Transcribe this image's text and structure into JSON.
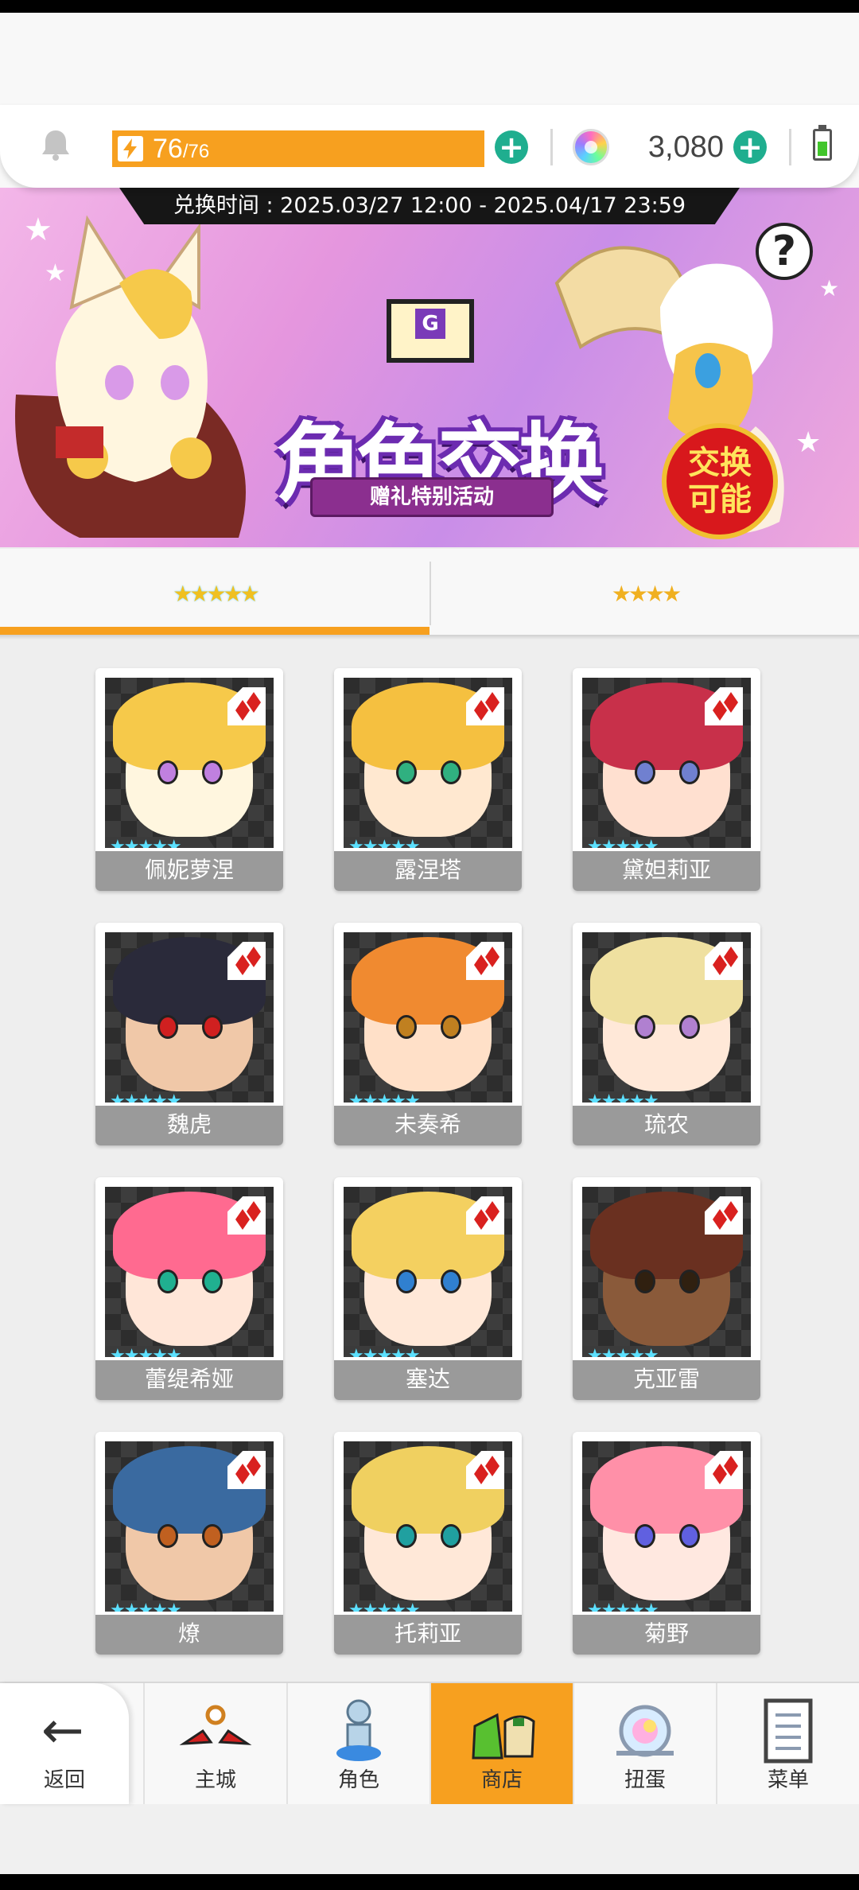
{
  "hud": {
    "stamina_value": "76",
    "stamina_max": "/76",
    "stamina_fraction": 1.0,
    "gem_count": "3,080",
    "icons": [
      "bell-icon",
      "lightning-icon",
      "plus-icon",
      "gem-icon",
      "battery-icon"
    ]
  },
  "banner": {
    "date_range": "兑换时间 : 2025.03/27 12:00 - 2025.04/17 23:59",
    "title": "角色交换",
    "subtitle": "赠礼特别活动",
    "badge_line1": "交换",
    "badge_line2": "可能",
    "help": "?",
    "envelope_letter": "G"
  },
  "tabs": [
    {
      "stars": "★★★★★",
      "rarity": 5,
      "active": true
    },
    {
      "stars": "★★★★",
      "rarity": 4,
      "active": false
    }
  ],
  "characters": [
    {
      "name": "佩妮萝涅",
      "stars": "★★★★★"
    },
    {
      "name": "露涅塔",
      "stars": "★★★★★"
    },
    {
      "name": "黛妲莉亚",
      "stars": "★★★★★"
    },
    {
      "name": "魏虎",
      "stars": "★★★★★"
    },
    {
      "name": "未奏希",
      "stars": "★★★★★"
    },
    {
      "name": "琉农",
      "stars": "★★★★★"
    },
    {
      "name": "蕾缇希娅",
      "stars": "★★★★★"
    },
    {
      "name": "塞达",
      "stars": "★★★★★"
    },
    {
      "name": "克亚雷",
      "stars": "★★★★★"
    },
    {
      "name": "燎",
      "stars": "★★★★★"
    },
    {
      "name": "托莉亚",
      "stars": "★★★★★"
    },
    {
      "name": "菊野",
      "stars": "★★★★★"
    }
  ],
  "nav": {
    "back": "返回",
    "items": [
      {
        "label": "主城",
        "icon": "castle-icon"
      },
      {
        "label": "角色",
        "icon": "character-icon"
      },
      {
        "label": "商店",
        "icon": "shop-icon",
        "active": true
      },
      {
        "label": "扭蛋",
        "icon": "gacha-icon"
      },
      {
        "label": "菜单",
        "icon": "menu-icon"
      }
    ]
  },
  "colors": {
    "accent": "#f7a01f",
    "plus_button": "#1fae8f",
    "name_bar": "#9a9a9a",
    "badge_red": "#d9211f"
  }
}
